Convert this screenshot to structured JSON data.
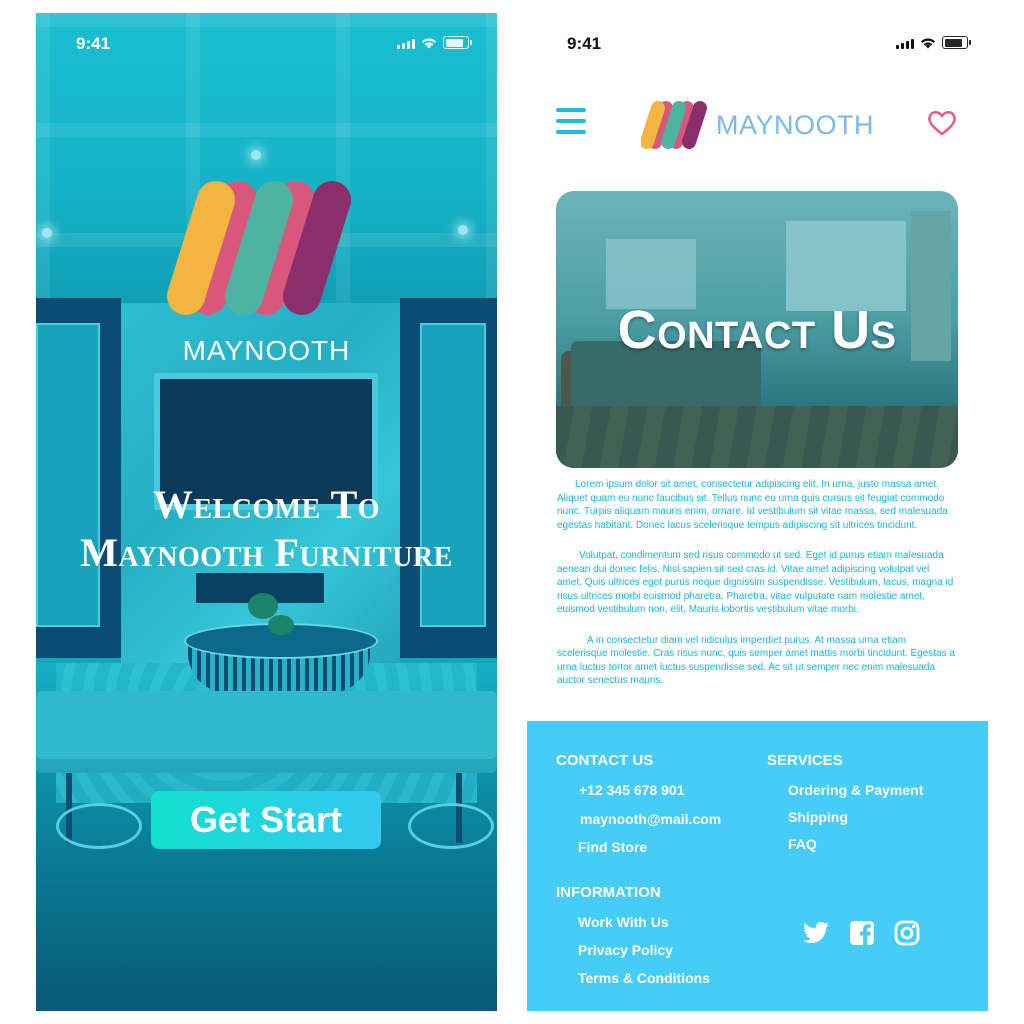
{
  "status_bar": {
    "time": "9:41"
  },
  "splash": {
    "brand": "MAYNOOTH",
    "welcome_line1": "Welcome To",
    "welcome_line2": "Maynooth Furniture",
    "cta": "Get Start"
  },
  "contact_page": {
    "brand": "MAYNOOTH",
    "hero_title": "Contact Us",
    "paragraphs": [
      "Lorem ipsum dolor sit amet, consectetur adipiscing elit. In urna, justo massa amet. Aliquet quam eu nunc faucibus sit. Tellus nunc eu urna quis cursus sit feugiat commodo nunc. Turpis aliquam mauris enim, ornare. Id vestibulum sit vitae massa, sed malesuada egestas habitant. Donec lacus scelerisque tempus adipiscing sit ultrices tincidunt.",
      "Volutpat, condimentum sed risus commodo ut sed. Eget id purus etiam malesuada aenean dui donec felis. Nisl sapien sit sed cras id. Vitae amet adipiscing volutpat vel amet. Quis ultrices eget purus neque dignissim suspendisse. Vestibulum, lacus, magna id risus ultrices morbi euismod pharetra. Pharetra, vitae vulputate nam molestie amet, euismod vestibulum non, elit. Mauris lobortis vestibulum vitae morbi.",
      "A in consectetur diam vel ridiculus imperdiet purus. At massa urna etiam scelerisque molestie. Cras risus nunc, quis semper amet mattis morbi tincidunt. Egestas a urna luctus tortor amet luctus suspendisse sed. Ac sit ut semper nec enim malesuada auctor senectus mauris."
    ],
    "footer": {
      "contact_heading": "CONTACT US",
      "phone": "+12 345 678 901",
      "email": "maynooth@mail.com",
      "find_store": "Find Store",
      "services_heading": "SERVICES",
      "services": [
        "Ordering & Payment",
        "Shipping",
        "FAQ"
      ],
      "information_heading": "INFORMATION",
      "information": [
        "Work With Us",
        "Privacy Policy",
        "Terms & Conditions"
      ],
      "social_icons": [
        "twitter-icon",
        "facebook-icon",
        "instagram-icon"
      ]
    }
  },
  "colors": {
    "logo_yellow": "#f2b540",
    "logo_teal": "#4fb3a1",
    "logo_purple": "#8a2f6b",
    "logo_pink": "#d9577a",
    "accent_blue": "#45cdf7",
    "heart": "#f05a78"
  }
}
